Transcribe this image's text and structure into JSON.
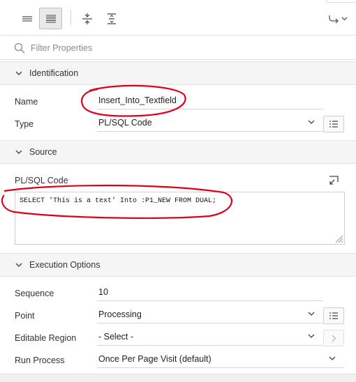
{
  "toolbar": {
    "icons": [
      "list-view-icon",
      "text-view-icon",
      "collapse-all-icon",
      "expand-all-icon",
      "go-to-group-icon"
    ]
  },
  "filter": {
    "placeholder": "Filter Properties"
  },
  "sections": {
    "identification": {
      "title": "Identification"
    },
    "source": {
      "title": "Source"
    },
    "execution": {
      "title": "Execution Options"
    }
  },
  "fields": {
    "name": {
      "label": "Name",
      "value": "Insert_Into_Textfield"
    },
    "type": {
      "label": "Type",
      "value": "PL/SQL Code"
    },
    "plsql": {
      "label": "PL/SQL Code",
      "value": "SELECT 'This is a text' Into :P1_NEW FROM DUAL;"
    },
    "sequence": {
      "label": "Sequence",
      "value": "10"
    },
    "point": {
      "label": "Point",
      "value": "Processing"
    },
    "editable_region": {
      "label": "Editable Region",
      "value": "- Select -"
    },
    "run_process": {
      "label": "Run Process",
      "value": "Once Per Page Visit (default)"
    }
  },
  "colors": {
    "annotation": "#e0001a",
    "section_bg": "#f5f5f5"
  }
}
